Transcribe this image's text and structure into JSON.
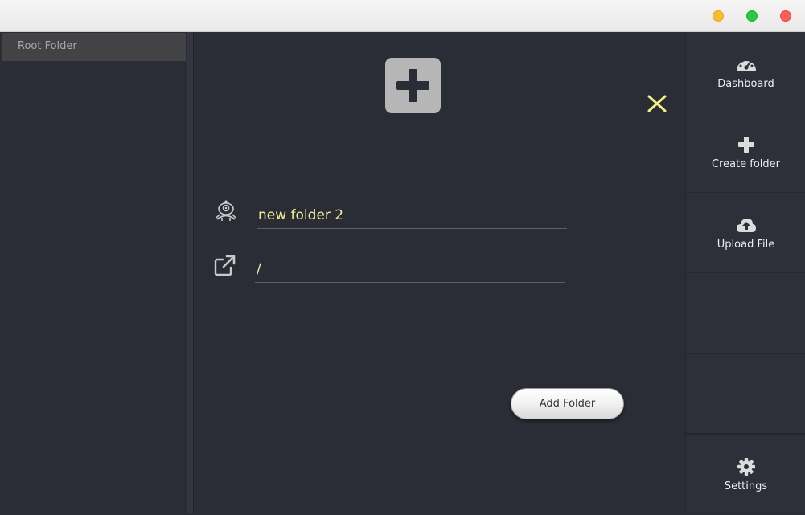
{
  "sidebar": {
    "items": [
      {
        "label": "Root Folder"
      }
    ]
  },
  "form": {
    "name_value": "new folder 2",
    "path_value": "/",
    "submit_label": "Add Folder",
    "name_icon": "folder-monster-icon",
    "path_icon": "external-link-icon",
    "header_icon": "plus-square-icon",
    "close_icon": "close-icon"
  },
  "nav": {
    "items": [
      {
        "label": "Dashboard",
        "icon": "dashboard-icon"
      },
      {
        "label": "Create folder",
        "icon": "plus-icon"
      },
      {
        "label": "Upload File",
        "icon": "cloud-upload-icon"
      },
      {
        "label": "Settings",
        "icon": "gear-icon"
      }
    ]
  },
  "colors": {
    "background": "#2a2d36",
    "accent_text": "#f3ef93",
    "close_icon": "#f4ef7f",
    "traffic_close": "#fd5f57",
    "traffic_minimize": "#f8bd2e",
    "traffic_maximize": "#2ec840"
  }
}
